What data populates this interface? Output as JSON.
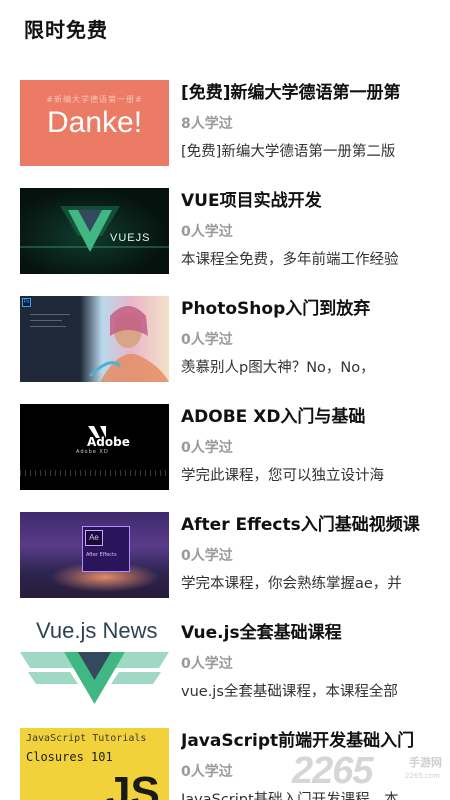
{
  "section": {
    "title": "限时免费"
  },
  "courses": [
    {
      "title": "[免费]新编大学德语第一册第",
      "count": "8人学过",
      "desc": "[免费]新编大学德语第一册第二版",
      "thumb_text": "Danke!",
      "thumb_subtext": "#新编大学德语第一册#"
    },
    {
      "title": "VUE项目实战开发",
      "count": "0人学过",
      "desc": "本课程全免费，多年前端工作经验",
      "thumb_text": "VUEJS"
    },
    {
      "title": "PhotoShop入门到放弃",
      "count": "0人学过",
      "desc": "羡慕别人p图大神？No，No，",
      "thumb_text": "Ps"
    },
    {
      "title": "ADOBE XD入门与基础",
      "count": "0人学过",
      "desc": "学完此课程，您可以独立设计海",
      "thumb_text": "Adobe",
      "thumb_subtext": "Adobe XD"
    },
    {
      "title": "After Effects入门基础视频课",
      "count": "0人学过",
      "desc": "学完本课程，你会熟练掌握ae，并",
      "thumb_text": "Ae",
      "thumb_subtext": "After Effects"
    },
    {
      "title": "Vue.js全套基础课程",
      "count": "0人学过",
      "desc": "vue.js全套基础课程，本课程全部",
      "thumb_text": "Vue.js News"
    },
    {
      "title": "JavaScript前端开发基础入门",
      "count": "0人学过",
      "desc": "JavaScript基础入门开发课程，本",
      "thumb_text": "JavaScript Tutorials",
      "thumb_subtext": "Closures 101",
      "thumb_logo": "JS"
    }
  ],
  "watermark": {
    "number": "2265",
    "site": "手游网",
    "url": "2265.com"
  },
  "colors": {
    "danke_bg": "#ec7b65",
    "vue_green": "#41b883",
    "vue_dark": "#35495e",
    "js_yellow": "#f2d23a"
  }
}
